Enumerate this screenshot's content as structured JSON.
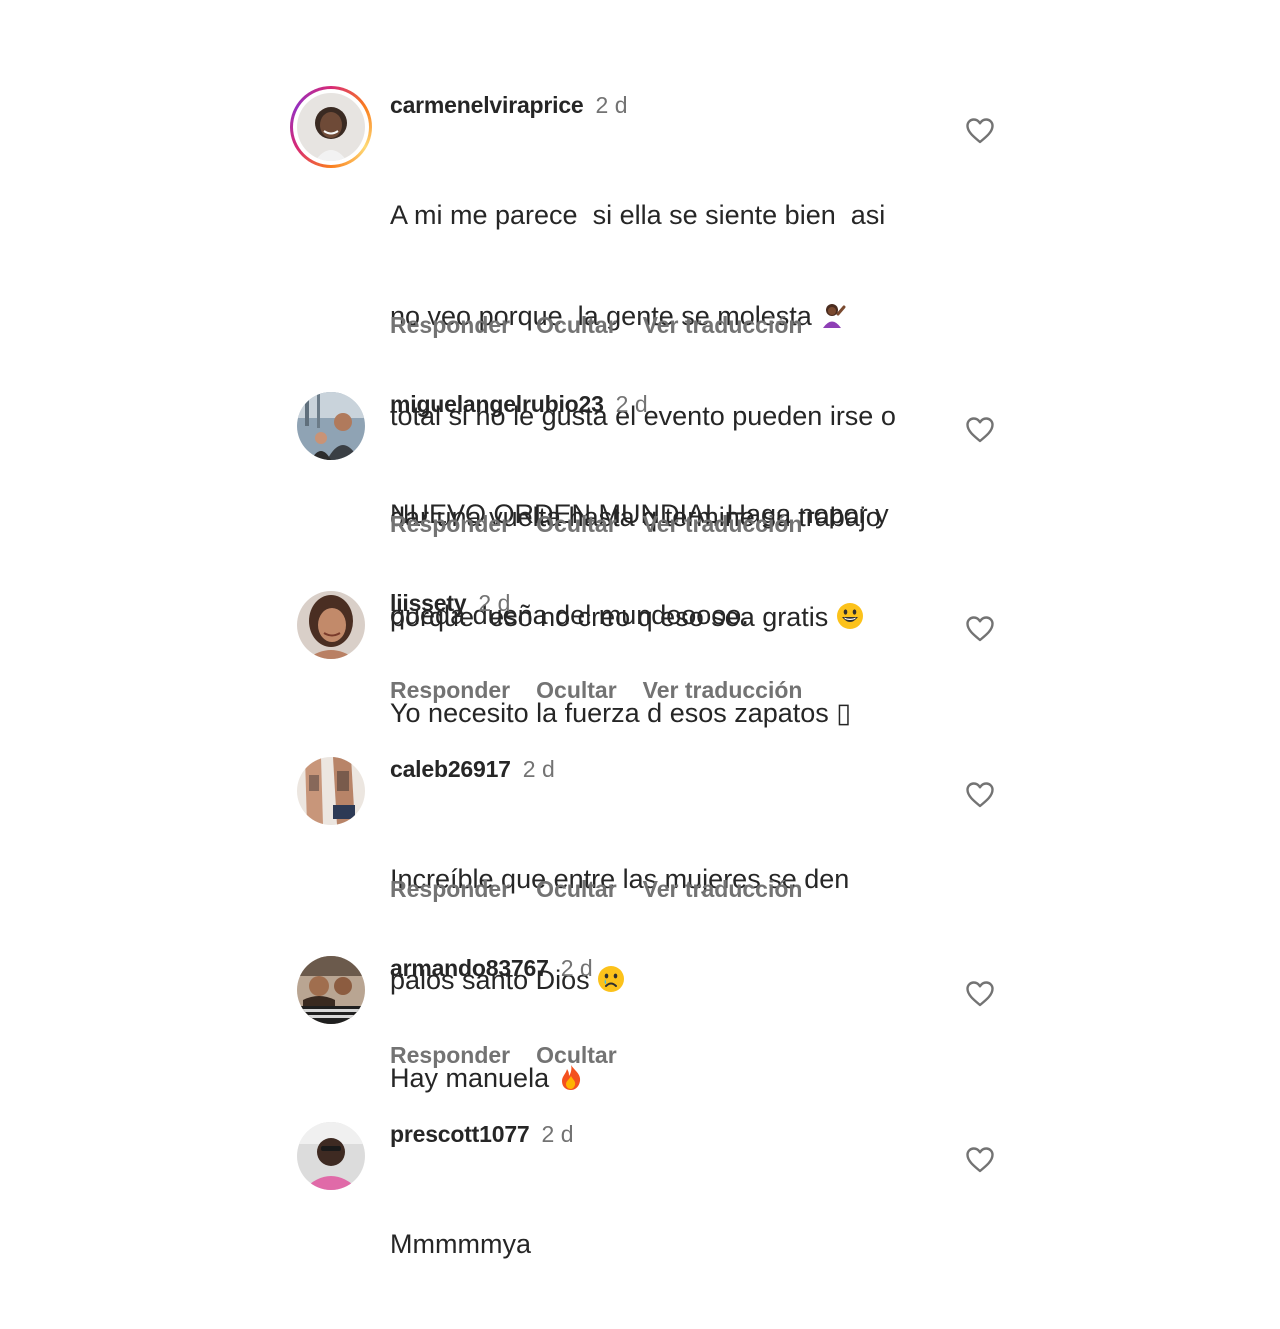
{
  "comments": [
    {
      "username": "carmenelviraprice",
      "time": "2 d",
      "lines": [
        "A mi me parece  si ella se siente bien  asi",
        "no veo porque  la gente se molesta ",
        "total si no le gusta el evento pueden irse o",
        "dar una vuelta hasta q termine su trabajo",
        "porque  eso no creo q eso sea gratis "
      ],
      "actions": [
        "Responder",
        "Ocultar",
        "Ver traducción"
      ]
    },
    {
      "username": "miguelangelrubio23",
      "time": "2 d",
      "lines": [
        "NUEVO ORDEN MUNDIAL Haga nopor y",
        "queda dueña del mundooooo."
      ],
      "actions": [
        "Responder",
        "Ocultar",
        "Ver traducción"
      ]
    },
    {
      "username": "liissety",
      "time": "2 d",
      "lines": [
        "Yo necesito la fuerza d esos zapatos ▯"
      ],
      "actions": [
        "Responder",
        "Ocultar",
        "Ver traducción"
      ]
    },
    {
      "username": "caleb26917",
      "time": "2 d",
      "lines": [
        "Increíble que entre las mujeres se den",
        "palos santo Dios "
      ],
      "actions": [
        "Responder",
        "Ocultar",
        "Ver traducción"
      ]
    },
    {
      "username": "armando83767",
      "time": "2 d",
      "lines": [
        "Hay manuela "
      ],
      "actions": [
        "Responder",
        "Ocultar"
      ]
    },
    {
      "username": "prescott1077",
      "time": "2 d",
      "lines": [
        "Mmmmmya"
      ],
      "actions": []
    }
  ],
  "icons": {
    "like": "heart-outline-icon",
    "emoji_1": "woman-tipping-hand-emoji",
    "emoji_2": "grinning-face-emoji",
    "emoji_3": "crying-face-emoji",
    "emoji_4": "fire-emoji"
  },
  "colors": {
    "text": "#262626",
    "secondary": "#737373",
    "story_ring": "#d62976"
  }
}
